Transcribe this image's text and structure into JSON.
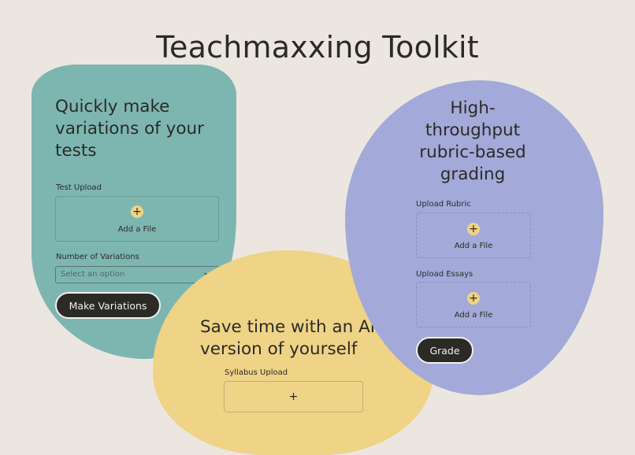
{
  "page": {
    "title": "Teachmaxxing Toolkit"
  },
  "colors": {
    "background": "#ebe6df",
    "teal": "#7db6b1",
    "yellow": "#efd386",
    "purple": "#a3aad9",
    "dark": "#2b2a27"
  },
  "variations_card": {
    "heading": "Quickly make variations of your tests",
    "upload_label": "Test Upload",
    "upload_text": "Add a File",
    "upload_icon": "plus-icon",
    "variations_label": "Number of Variations",
    "select_placeholder": "Select an option",
    "button_label": "Make Variations"
  },
  "ai_card": {
    "heading": "Save time with an AI version of yourself",
    "upload_label": "Syllabus Upload",
    "upload_icon": "plus-icon"
  },
  "grading_card": {
    "heading": "High-throughput rubric-based grading",
    "rubric_label": "Upload Rubric",
    "rubric_text": "Add a File",
    "essays_label": "Upload Essays",
    "essays_text": "Add a File",
    "button_label": "Grade"
  }
}
